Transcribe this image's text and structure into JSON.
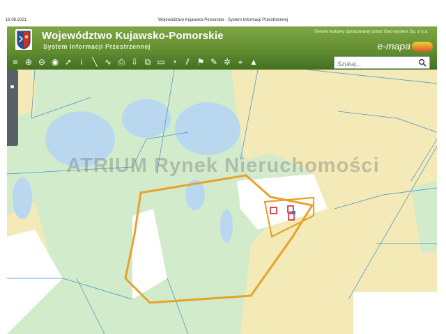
{
  "print": {
    "date": "19.08.2021",
    "title": "Województwo Kujawsko-Pomorskie - System Informacji Przestrzennej"
  },
  "header": {
    "title": "Województwo Kujawsko-Pomorskie",
    "subtitle": "System Informacji Przestrzennej",
    "credit": "Serwis testowy opracowany przez Geo-system Sp. z o.o.",
    "brand": "e-mapa",
    "crest_icon": "coat-of-arms-icon"
  },
  "toolbar": {
    "tools": [
      {
        "name": "layers-tool",
        "icon": "layers-icon",
        "glyph": "≡"
      },
      {
        "name": "zoom-in-tool",
        "icon": "zoom-in-icon",
        "glyph": "⊕"
      },
      {
        "name": "zoom-out-tool",
        "icon": "zoom-out-icon",
        "glyph": "⊖"
      },
      {
        "name": "full-extent-tool",
        "icon": "globe-icon",
        "glyph": "◉"
      },
      {
        "name": "select-tool",
        "icon": "arrow-pointer-icon",
        "glyph": "➚"
      },
      {
        "name": "info-tool",
        "icon": "info-icon",
        "glyph": "i"
      },
      {
        "name": "measure-distance-tool",
        "icon": "ruler-icon",
        "glyph": "╲"
      },
      {
        "name": "measure-path-tool",
        "icon": "path-icon",
        "glyph": "∿"
      },
      {
        "name": "print-tool",
        "icon": "printer-icon",
        "glyph": "⎙"
      },
      {
        "name": "download-tool",
        "icon": "download-icon",
        "glyph": "⇩"
      },
      {
        "name": "export-tool",
        "icon": "export-icon",
        "glyph": "⧉"
      },
      {
        "name": "window-tool",
        "icon": "window-icon",
        "glyph": "▭"
      },
      {
        "name": "comment-tool",
        "icon": "speech-bubble-icon",
        "glyph": "◔"
      },
      {
        "name": "hatch-tool",
        "icon": "hatch-icon",
        "glyph": "⫽"
      },
      {
        "name": "bookmark-tool",
        "icon": "bookmark-icon",
        "glyph": "⚑"
      },
      {
        "name": "draw-tool",
        "icon": "pencil-icon",
        "glyph": "✎"
      },
      {
        "name": "markers-tool",
        "icon": "markers-icon",
        "glyph": "✲"
      },
      {
        "name": "location-tool",
        "icon": "location-icon",
        "glyph": "⌖"
      },
      {
        "name": "terrain-tool",
        "icon": "mountain-icon",
        "glyph": "▲"
      }
    ]
  },
  "search": {
    "placeholder": "Szukaj..."
  },
  "watermark": "ATRIUM Rynek Nieruchomości",
  "colors": {
    "header_green": "#6e9a3a",
    "toolbar_green": "#4f7c26",
    "water": "#b9d8f0",
    "meadow": "#d2ebcb",
    "field": "#f3eab7",
    "plot_boundary": "#e7a22b",
    "building": "#d6202f",
    "parcel_line": "#3f8fc9"
  }
}
